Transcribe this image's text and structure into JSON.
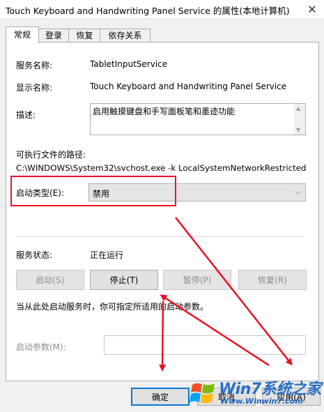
{
  "window": {
    "title": "Touch Keyboard and Handwriting Panel Service 的属性(本地计算机)",
    "close_glyph": "✕"
  },
  "tabs": [
    {
      "label": "常规",
      "active": true
    },
    {
      "label": "登录",
      "active": false
    },
    {
      "label": "恢复",
      "active": false
    },
    {
      "label": "依存关系",
      "active": false
    }
  ],
  "general": {
    "service_name_label": "服务名称:",
    "service_name_value": "TabletInputService",
    "display_name_label": "显示名称:",
    "display_name_value": "Touch Keyboard and Handwriting Panel Service",
    "description_label": "描述:",
    "description_value": "启用触摸键盘和手写面板笔和墨迹功能",
    "exe_path_label": "可执行文件的路径:",
    "exe_path_value": "C:\\WINDOWS\\System32\\svchost.exe -k LocalSystemNetworkRestricted",
    "startup_type_label": "启动类型(E):",
    "startup_type_value": "禁用",
    "service_status_label": "服务状态:",
    "service_status_value": "正在运行",
    "start_button": "启动(S)",
    "stop_button": "停止(T)",
    "pause_button": "暂停(P)",
    "resume_button": "恢复(R)",
    "hint_text": "当从此处启动服务时，你可指定所适用的启动参数。",
    "start_params_label": "启动参数(M):",
    "start_params_value": ""
  },
  "dialog_buttons": {
    "ok": "确定",
    "cancel": "取消",
    "apply": "应用(A)"
  },
  "watermark": {
    "brand": "Win7系统之家",
    "url": "Www.Winwin7.com"
  },
  "colors": {
    "annotation_red": "#e81123",
    "focus_blue": "#0078d7"
  }
}
